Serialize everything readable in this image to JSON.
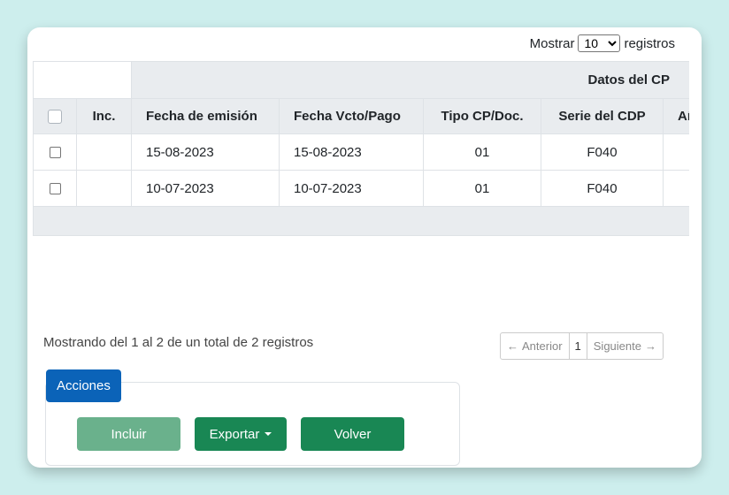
{
  "length_menu": {
    "prefix": "Mostrar",
    "selected": "10",
    "suffix": "registros"
  },
  "table": {
    "group_header": "Datos del CP",
    "columns": [
      "Inc.",
      "Fecha de emisión",
      "Fecha Vcto/Pago",
      "Tipo CP/Doc.",
      "Serie del CDP",
      "Año"
    ],
    "rows": [
      {
        "emision": "15-08-2023",
        "vcto": "15-08-2023",
        "tipo": "01",
        "serie": "F040"
      },
      {
        "emision": "10-07-2023",
        "vcto": "10-07-2023",
        "tipo": "01",
        "serie": "F040"
      }
    ]
  },
  "info": "Mostrando del 1 al 2 de un total de 2 registros",
  "pagination": {
    "prev": "Anterior",
    "current": "1",
    "next": "Siguiente"
  },
  "actions": {
    "title": "Acciones",
    "incluir": "Incluir",
    "exportar": "Exportar",
    "volver": "Volver"
  },
  "colors": {
    "background": "#cdeeed",
    "primary": "#0b63b8",
    "success": "#198754",
    "success_disabled": "#6ab18c"
  },
  "icons": {
    "prev": "arrow-left-icon",
    "next": "arrow-right-icon",
    "dropdown": "caret-down-icon"
  }
}
